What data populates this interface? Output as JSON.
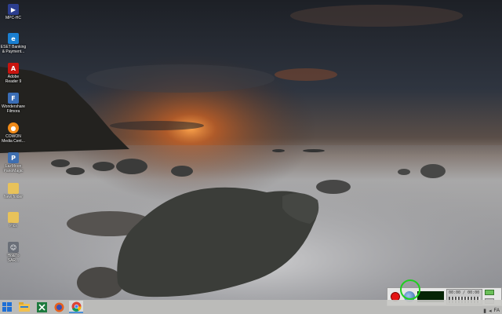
{
  "desktop": {
    "icons": [
      {
        "label": "MPC-HC",
        "icon": "mpc-hc-icon",
        "color": "#2c3e8f"
      },
      {
        "label": "ESET Banking\n& Payment...",
        "icon": "eset-banking-icon",
        "color": "#1a7fd1"
      },
      {
        "label": "Adobe\nReader 9",
        "icon": "adobe-reader-icon",
        "color": "#c8140f"
      },
      {
        "label": "Wondershare\nFilmora",
        "icon": "filmora-icon",
        "color": "#3a6db5"
      },
      {
        "label": "COWON\nMedia Cent...",
        "icon": "cowon-icon",
        "color": "#f08a18"
      },
      {
        "label": "LazMoon\nPanoMagic",
        "icon": "panomagic-icon",
        "color": "#3f6fb0"
      },
      {
        "label": "New folder",
        "icon": "folder-icon",
        "color": "#e8c25a"
      },
      {
        "label": "Pics",
        "icon": "folder-icon",
        "color": "#e8c25a"
      },
      {
        "label": "Ho&To\nSAR...",
        "icon": "user-photo-icon",
        "color": "#6a6f78"
      }
    ]
  },
  "taskbar": {
    "items": [
      {
        "name": "windows-start-icon",
        "active": false
      },
      {
        "name": "file-explorer-icon",
        "active": false
      },
      {
        "name": "excel-icon",
        "active": false
      },
      {
        "name": "firefox-icon",
        "active": false
      },
      {
        "name": "chrome-icon",
        "active": true
      }
    ]
  },
  "recorder": {
    "time": "00:00 / 00:00"
  },
  "tray": {
    "language": "FA"
  },
  "colors": {
    "accent": "#1fcf1f",
    "record": "#e31212"
  }
}
